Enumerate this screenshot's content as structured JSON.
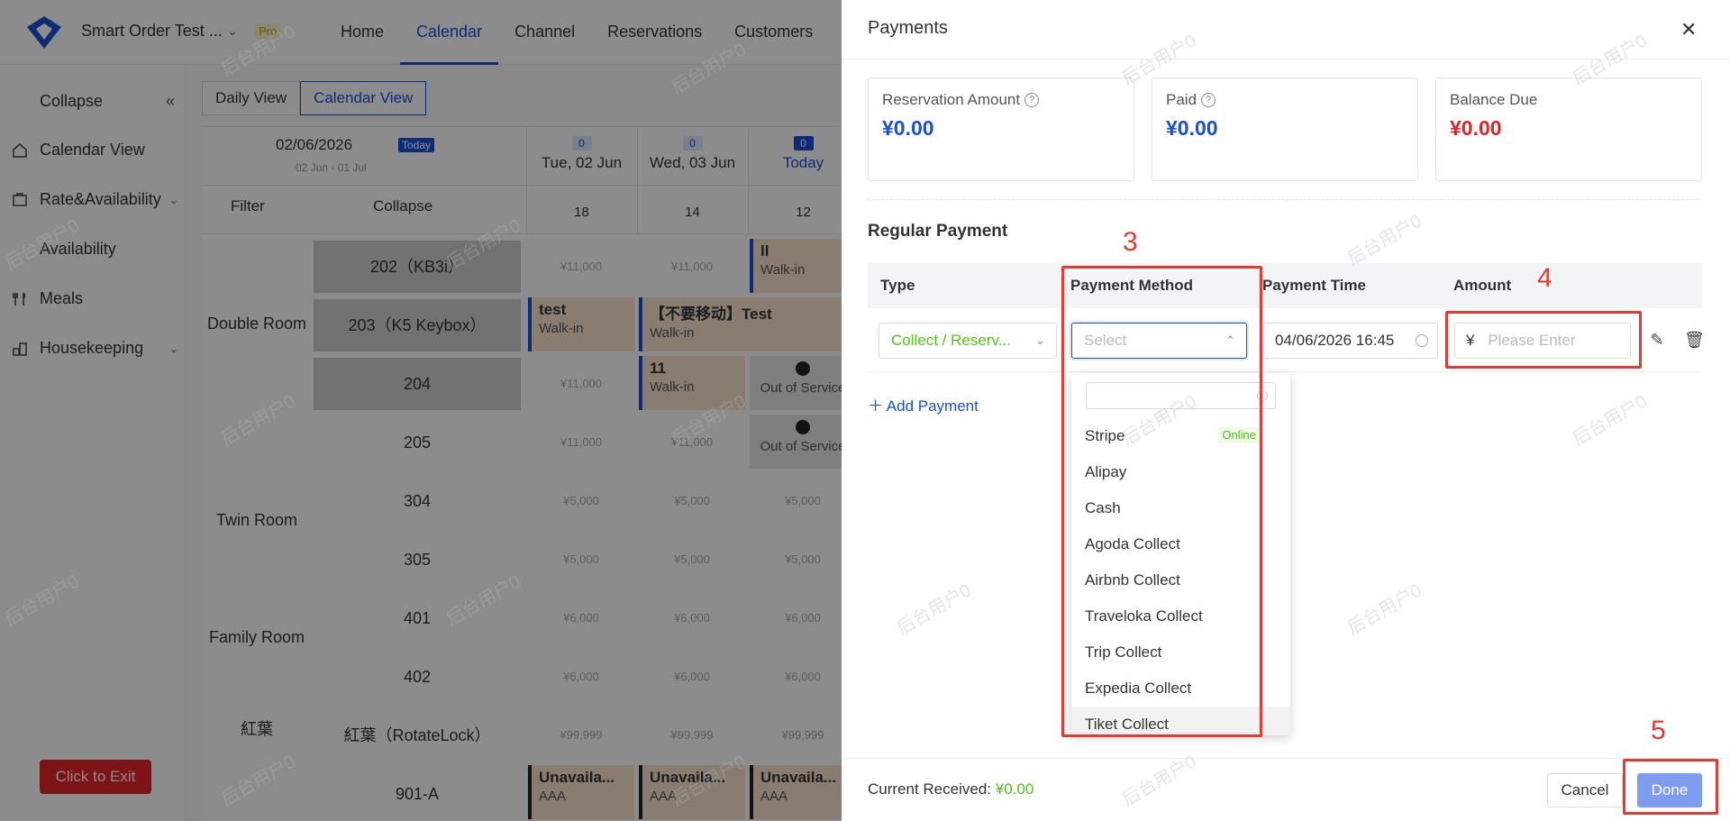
{
  "app": {
    "hotel_name": "Smart Order Test ...",
    "plan_badge": "Pro",
    "nav": [
      "Home",
      "Calendar",
      "Channel",
      "Reservations",
      "Customers"
    ],
    "active_nav": "Calendar"
  },
  "sidebar": {
    "collapse_label": "Collapse",
    "items": [
      {
        "label": "Calendar View",
        "icon": "home-icon"
      },
      {
        "label": "Rate&Availability",
        "icon": "price-tag-icon"
      },
      {
        "label": "Availability",
        "icon": "availability-icon"
      },
      {
        "label": "Meals",
        "icon": "utensils-icon"
      },
      {
        "label": "Housekeeping",
        "icon": "housekeeping-icon"
      }
    ],
    "exit_button": "Click to Exit"
  },
  "calendar": {
    "tabs": [
      "Daily View",
      "Calendar View"
    ],
    "date": "02/06/2026",
    "today_badge": "Today",
    "range": "02 Jun - 01 Jul",
    "filter_label": "Filter",
    "collapse_label": "Collapse",
    "columns": [
      {
        "count": "0",
        "day": "Tue, 02 Jun",
        "avail": "18"
      },
      {
        "count": "0",
        "day": "Wed, 03 Jun",
        "avail": "14"
      },
      {
        "count": "0",
        "day": "Today",
        "avail": "12"
      }
    ],
    "room_types": [
      "Double Room",
      "Twin Room",
      "Family Room",
      "紅葉"
    ],
    "rooms": [
      "202（KB3i）",
      "203（K5 Keybox）",
      "204",
      "205",
      "304",
      "305",
      "401",
      "402",
      "紅葉（RotateLock）",
      "901-A"
    ],
    "prices": {
      "r202": [
        "¥11,000",
        "¥11,000"
      ],
      "r204": [
        "¥11,000"
      ],
      "r205": [
        "¥11,000",
        "¥11,000"
      ],
      "r304": [
        "¥5,000",
        "¥5,000",
        "¥5,000"
      ],
      "r305": [
        "¥5,000",
        "¥5,000",
        "¥5,000"
      ],
      "r401": [
        "¥6,000",
        "¥6,000",
        "¥6,000"
      ],
      "r402": [
        "¥6,000",
        "¥6,000",
        "¥6,000"
      ],
      "rkoyo": [
        "¥99,999",
        "¥99,999",
        "¥99,999"
      ]
    },
    "reservations": {
      "ll": {
        "title": "ll",
        "sub": "Walk-in"
      },
      "test": {
        "title": "test",
        "sub": "Walk-in"
      },
      "dont_move": {
        "title": "【不要移动】Test",
        "sub": "Walk-in"
      },
      "r11": {
        "title": "11",
        "sub": "Walk-in"
      },
      "oos": {
        "sub": "Out of Service"
      },
      "unavail": {
        "title": "Unavaila...",
        "sub": "AAA"
      }
    }
  },
  "watermark": "后台用户0",
  "payments": {
    "title": "Payments",
    "summary": [
      {
        "label": "Reservation Amount",
        "value": "¥0.00",
        "has_help": true,
        "color": "#1b4fd8"
      },
      {
        "label": "Paid",
        "value": "¥0.00",
        "has_help": true,
        "color": "#1b4fd8"
      },
      {
        "label": "Balance Due",
        "value": "¥0.00",
        "has_help": false,
        "color": "#e0242a"
      }
    ],
    "section_title": "Regular Payment",
    "columns": [
      "Type",
      "Payment Method",
      "Payment Time",
      "Amount"
    ],
    "row": {
      "type": "Collect / Reserv...",
      "method_placeholder": "Select",
      "time": "04/06/2026 16:45",
      "currency": "¥",
      "amount_placeholder": "Please Enter"
    },
    "add_payment": "Add Payment",
    "methods": [
      {
        "label": "Stripe",
        "tag": "Online"
      },
      {
        "label": "Alipay"
      },
      {
        "label": "Cash"
      },
      {
        "label": "Agoda Collect"
      },
      {
        "label": "Airbnb Collect"
      },
      {
        "label": "Traveloka Collect"
      },
      {
        "label": "Trip Collect"
      },
      {
        "label": "Expedia Collect"
      },
      {
        "label": "Tiket Collect"
      }
    ],
    "current_received_label": "Current Received:",
    "current_received_value": "¥0.00",
    "cancel": "Cancel",
    "done": "Done"
  },
  "annotations": [
    "3",
    "4",
    "5"
  ],
  "colors": {
    "accent": "#1b4fd8",
    "success": "#52c41a",
    "danger": "#e0242a",
    "annotation": "#e53935"
  }
}
